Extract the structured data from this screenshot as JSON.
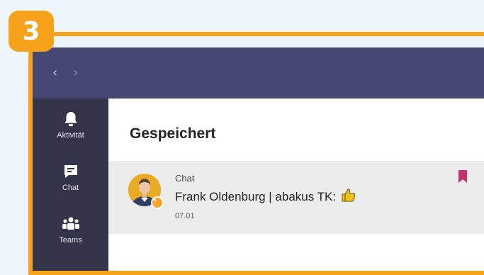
{
  "step": {
    "number": "3"
  },
  "nav": {
    "back_icon": "chevron-left-icon",
    "forward_icon": "chevron-right-icon"
  },
  "rail": {
    "items": [
      {
        "label": "Aktivität",
        "icon": "bell-icon"
      },
      {
        "label": "Chat",
        "icon": "chat-icon"
      },
      {
        "label": "Teams",
        "icon": "teams-icon"
      }
    ]
  },
  "main": {
    "title": "Gespeichert",
    "saved_items": [
      {
        "source": "Chat",
        "text": "Frank Oldenburg | abakus TK:",
        "emoji": "👍",
        "date": "07.01",
        "status": "away"
      }
    ]
  },
  "colors": {
    "accent": "#f7a21b",
    "titlebar": "#464775",
    "rail": "#33344a",
    "bookmark": "#c4316c"
  }
}
